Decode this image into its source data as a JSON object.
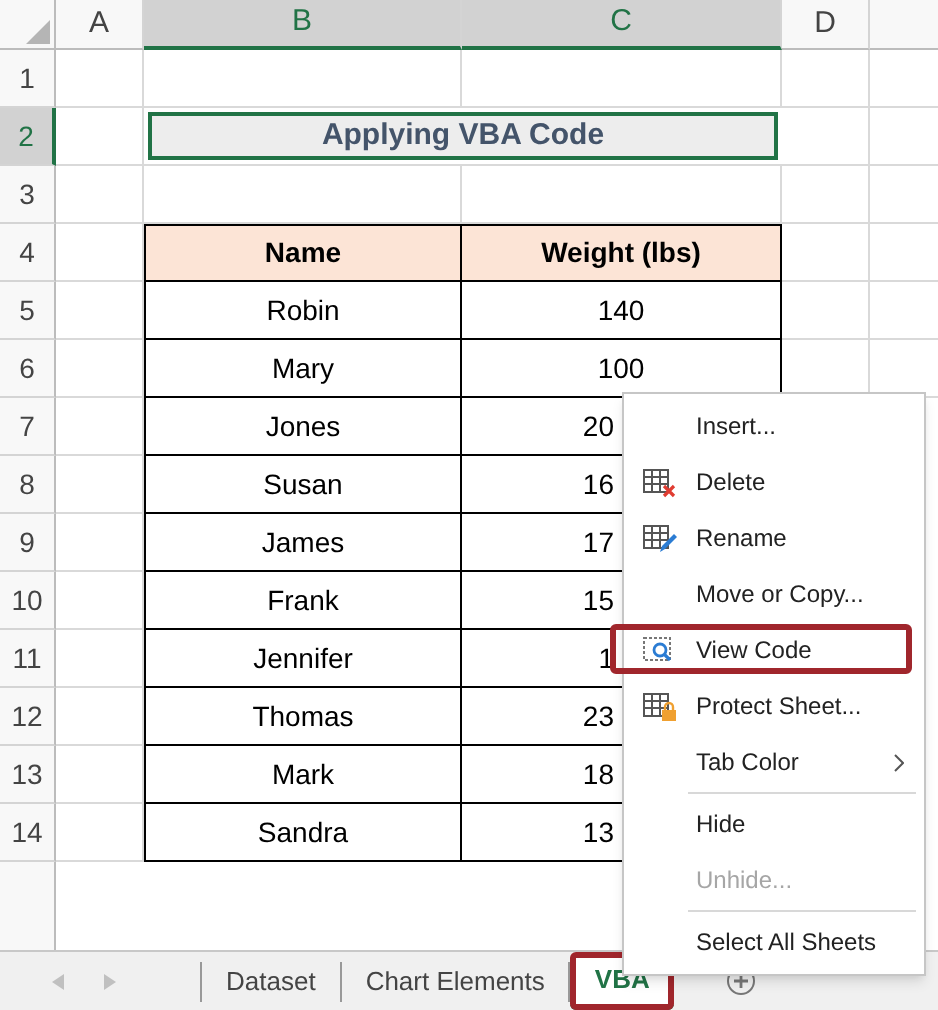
{
  "columns": [
    {
      "label": "A",
      "selected": false
    },
    {
      "label": "B",
      "selected": true
    },
    {
      "label": "C",
      "selected": true
    },
    {
      "label": "D",
      "selected": false
    }
  ],
  "rows": [
    {
      "label": "1",
      "selected": false
    },
    {
      "label": "2",
      "selected": true
    },
    {
      "label": "3",
      "selected": false
    },
    {
      "label": "4",
      "selected": false
    },
    {
      "label": "5",
      "selected": false
    },
    {
      "label": "6",
      "selected": false
    },
    {
      "label": "7",
      "selected": false
    },
    {
      "label": "8",
      "selected": false
    },
    {
      "label": "9",
      "selected": false
    },
    {
      "label": "10",
      "selected": false
    },
    {
      "label": "11",
      "selected": false
    },
    {
      "label": "12",
      "selected": false
    },
    {
      "label": "13",
      "selected": false
    },
    {
      "label": "14",
      "selected": false
    }
  ],
  "title_cell": {
    "text": "Applying VBA Code",
    "selected": true
  },
  "table": {
    "columns": [
      "Name",
      "Weight (lbs)"
    ],
    "rows": [
      {
        "name": "Robin",
        "weight": "140",
        "clipped": false
      },
      {
        "name": "Mary",
        "weight": "100",
        "clipped": false
      },
      {
        "name": "Jones",
        "weight": "20",
        "clipped": true
      },
      {
        "name": "Susan",
        "weight": "16",
        "clipped": true
      },
      {
        "name": "James",
        "weight": "17",
        "clipped": true
      },
      {
        "name": "Frank",
        "weight": "15",
        "clipped": true
      },
      {
        "name": "Jennifer",
        "weight": "1",
        "clipped": true
      },
      {
        "name": "Thomas",
        "weight": "23",
        "clipped": true
      },
      {
        "name": "Mark",
        "weight": "18",
        "clipped": true
      },
      {
        "name": "Sandra",
        "weight": "13",
        "clipped": true
      }
    ]
  },
  "context_menu": {
    "items": [
      {
        "kind": "plain",
        "label": "Insert...",
        "disabled": false,
        "highlighted": false
      },
      {
        "kind": "delete",
        "label": "Delete",
        "disabled": false,
        "highlighted": false
      },
      {
        "kind": "rename",
        "label": "Rename",
        "disabled": false,
        "highlighted": false
      },
      {
        "kind": "plain",
        "label": "Move or Copy...",
        "disabled": false,
        "highlighted": false
      },
      {
        "kind": "view_code",
        "label": "View Code",
        "disabled": false,
        "highlighted": true
      },
      {
        "kind": "protect",
        "label": "Protect Sheet...",
        "disabled": false,
        "highlighted": false
      },
      {
        "kind": "submenu",
        "label": "Tab Color",
        "disabled": false,
        "highlighted": false
      },
      {
        "kind": "separator"
      },
      {
        "kind": "plain",
        "label": "Hide",
        "disabled": false,
        "highlighted": false
      },
      {
        "kind": "plain",
        "label": "Unhide...",
        "disabled": true,
        "highlighted": false
      },
      {
        "kind": "separator"
      },
      {
        "kind": "plain",
        "label": "Select All Sheets",
        "disabled": false,
        "highlighted": false
      }
    ]
  },
  "sheet_tabs": [
    {
      "label": "Dataset",
      "selected": false,
      "highlighted": false
    },
    {
      "label": "Chart Elements",
      "selected": false,
      "highlighted": false
    },
    {
      "label": "VBA",
      "selected": true,
      "highlighted": true
    }
  ]
}
